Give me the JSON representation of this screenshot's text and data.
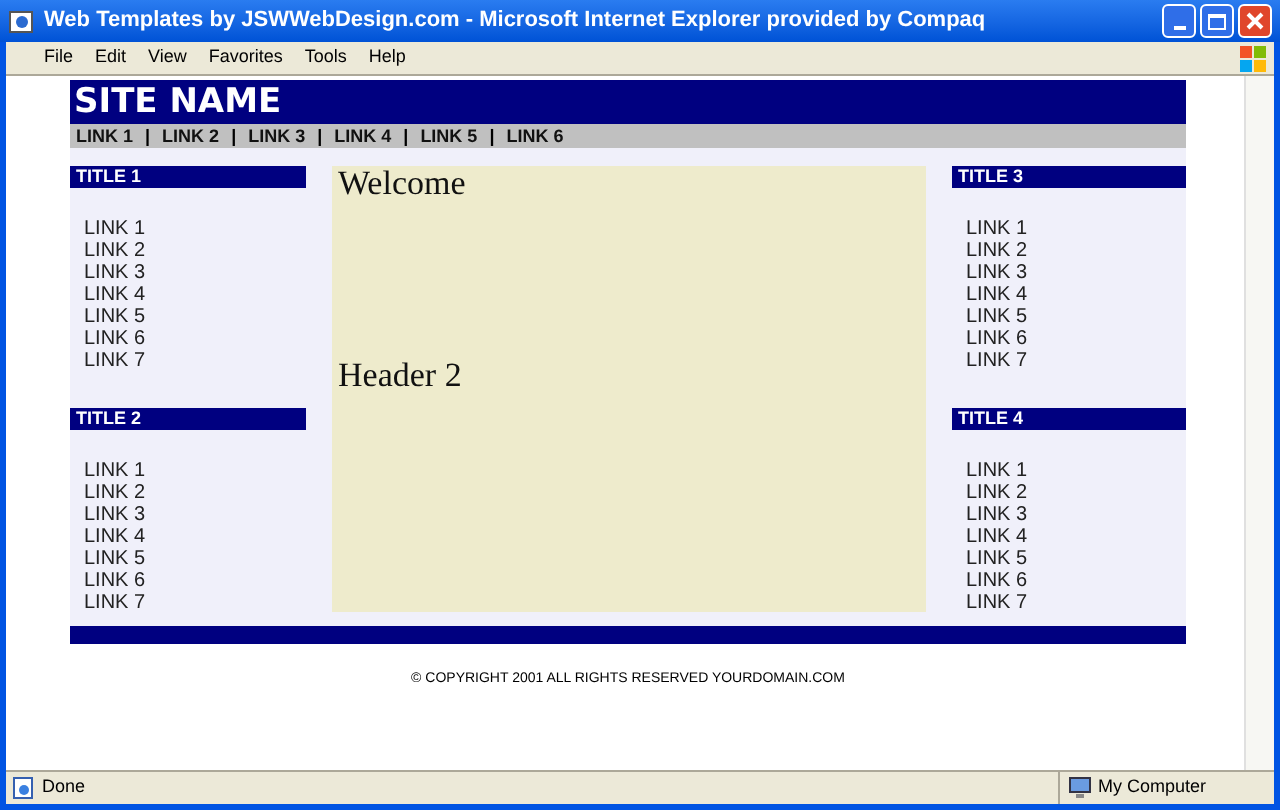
{
  "window": {
    "title": "Web Templates by JSWWebDesign.com - Microsoft Internet Explorer provided by Compaq"
  },
  "menu": [
    "File",
    "Edit",
    "View",
    "Favorites",
    "Tools",
    "Help"
  ],
  "site_name": "SITE NAME",
  "nav": {
    "links": [
      "LINK 1",
      "LINK 2",
      "LINK 3",
      "LINK 4",
      "LINK 5",
      "LINK 6"
    ],
    "separator": "|"
  },
  "left_boxes": [
    {
      "title": "TITLE 1",
      "links": [
        "LINK 1",
        "LINK 2",
        "LINK 3",
        "LINK 4",
        "LINK 5",
        "LINK 6",
        "LINK 7"
      ]
    },
    {
      "title": "TITLE 2",
      "links": [
        "LINK 1",
        "LINK 2",
        "LINK 3",
        "LINK 4",
        "LINK 5",
        "LINK 6",
        "LINK 7"
      ]
    }
  ],
  "content": {
    "headings": [
      "Welcome",
      "Header 2"
    ]
  },
  "right_boxes": [
    {
      "title": "TITLE 3",
      "links": [
        "LINK 1",
        "LINK 2",
        "LINK 3",
        "LINK 4",
        "LINK 5",
        "LINK 6",
        "LINK 7"
      ]
    },
    {
      "title": "TITLE 4",
      "links": [
        "LINK 1",
        "LINK 2",
        "LINK 3",
        "LINK 4",
        "LINK 5",
        "LINK 6",
        "LINK 7"
      ]
    }
  ],
  "footer": "© COPYRIGHT 2001 ALL RIGHTS RESERVED YOURDOMAIN.COM",
  "status_bar": {
    "text": "Done",
    "zone": "My Computer"
  }
}
